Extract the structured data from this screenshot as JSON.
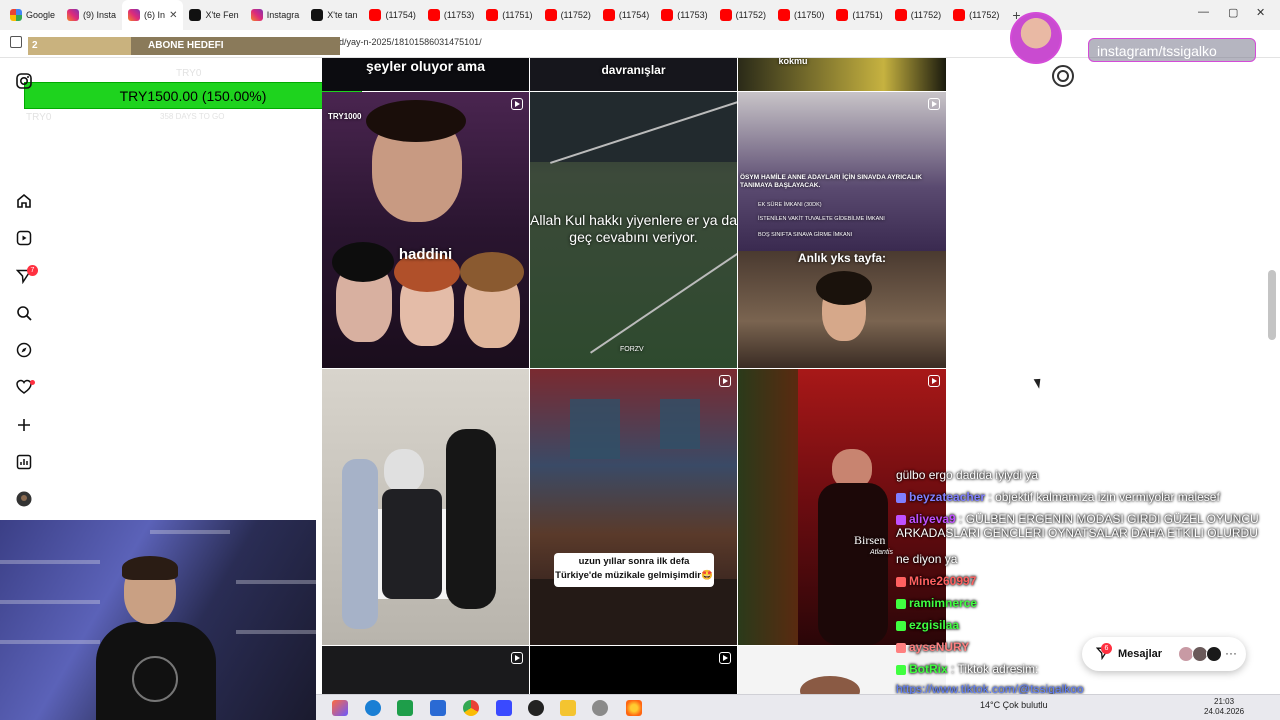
{
  "browser": {
    "tabs": [
      {
        "label": "Google",
        "icon": "google-icon",
        "active": false
      },
      {
        "label": "(9) Insta",
        "icon": "instagram-icon",
        "active": false
      },
      {
        "label": "(6) In",
        "icon": "instagram-icon",
        "active": true
      },
      {
        "label": "X'te Fen",
        "icon": "x-icon",
        "active": false
      },
      {
        "label": "Instagra",
        "icon": "instagram-icon",
        "active": false
      },
      {
        "label": "X'te tan",
        "icon": "x-icon",
        "active": false
      },
      {
        "label": "(11754)",
        "icon": "youtube-icon",
        "active": false
      },
      {
        "label": "(11753)",
        "icon": "youtube-icon",
        "active": false
      },
      {
        "label": "(11751)",
        "icon": "youtube-icon",
        "active": false
      },
      {
        "label": "(11752)",
        "icon": "youtube-icon",
        "active": false
      },
      {
        "label": "(11754)",
        "icon": "youtube-icon",
        "active": false
      },
      {
        "label": "(11753)",
        "icon": "youtube-icon",
        "active": false
      },
      {
        "label": "(11752)",
        "icon": "youtube-icon",
        "active": false
      },
      {
        "label": "(11750)",
        "icon": "youtube-icon",
        "active": false
      },
      {
        "label": "(11751)",
        "icon": "youtube-icon",
        "active": false
      },
      {
        "label": "(11752)",
        "icon": "youtube-icon",
        "active": false
      },
      {
        "label": "(11752)",
        "icon": "youtube-icon",
        "active": false
      }
    ],
    "new_tab": "+",
    "tab_menu": "⌄",
    "win_min": "—",
    "win_max": "▢",
    "win_close": "✕",
    "url": "instagram.com/tamerrer/saved/yay-n-2025/18101586031475101/"
  },
  "overlay": {
    "subscriber_count": "2",
    "subscriber_label": "ABONE HEDEFI",
    "subscriber_progress": 0.33,
    "donation_text": "TRY1500.00 (150.00%)",
    "donation_progress": 1.0,
    "ghost_left": "TRY0",
    "ghost_right": "TRY0",
    "ghost_days": "358 DAYS TO GO",
    "instagram_handle": "instagram/tssigalko"
  },
  "sidebar": {
    "icons": [
      "instagram-logo-icon",
      "home-icon",
      "reels-icon",
      "direct-icon",
      "search-icon",
      "explore-icon",
      "heart-icon",
      "create-icon",
      "dashboard-icon",
      "profile-icon"
    ],
    "direct_badge": "7"
  },
  "feed": {
    "posts": [
      {
        "caption": "şeyler oluyor ama"
      },
      {
        "caption": "davranışlar"
      },
      {
        "caption": "kokmu"
      },
      {
        "caption": "haddini",
        "tag": "TRY1000"
      },
      {
        "caption": "Allah Kul hakkı yiyenlere er ya da geç cevabını veriyor.",
        "tag": "FORZV"
      },
      {
        "caption": "ÖSYM HAMİLE ANNE ADAYLARI İÇİN SINAVDA AYRICALIK TANIMAYA BAŞLAYACAK."
      },
      {
        "caption": "Anlık yks tayfa:"
      },
      {
        "caption": ""
      },
      {
        "caption": "uzun yıllar sonra ilk defa Türkiye'de müzikale gelmişimdir🤩"
      },
      {
        "caption": "Birsen",
        "sub": "Atlantis"
      }
    ],
    "osym_bullets": [
      "EK SÜRE İMKANI (30DK)",
      "İSTENİLEN VAKİT TUVALETE GİDEBİLME İMKANI",
      "BOŞ SINIFTA SINAVA GİRME İMKANI"
    ]
  },
  "chat": {
    "messages": [
      {
        "user": "",
        "text": "gülbo ergo dadida iyiydi ya",
        "color": "#ffffff"
      },
      {
        "user": "beyzateacher",
        "text": "objektif kalmamıza izin vermiyolar malesef",
        "color": "#7f7fff"
      },
      {
        "user": "aliyeva9",
        "text": "GÜLBEN ERGENIN MODASI GIRDI GÜZEL OYUNCU ARKADASLARI GENCLERI OYNATSALAR DAHA ETKILI OLURDU",
        "color": "#c050ff"
      },
      {
        "user": "",
        "text": "ne diyon ya",
        "color": "#ffffff"
      },
      {
        "user": "Mine260997",
        "text": "",
        "color": "#ff6060"
      },
      {
        "user": "ramimnerce",
        "text": "",
        "color": "#40ff40"
      },
      {
        "user": "ezgisilaa",
        "text": "",
        "color": "#40ff40"
      },
      {
        "user": "ayseNURY",
        "text": "",
        "color": "#ff8080"
      },
      {
        "user": "BotRix",
        "text": "Tiktok adresim:",
        "color": "#40ff40"
      },
      {
        "user": "",
        "text": "https://www.tiktok.com/@tssigalkoo",
        "color": "#6080ff"
      }
    ]
  },
  "messages_button": {
    "label": "Mesajlar",
    "badge": "6"
  },
  "taskbar": {
    "weather": "14°C Çok bulutlu",
    "time": "21:03",
    "date": "24.04.2026"
  }
}
